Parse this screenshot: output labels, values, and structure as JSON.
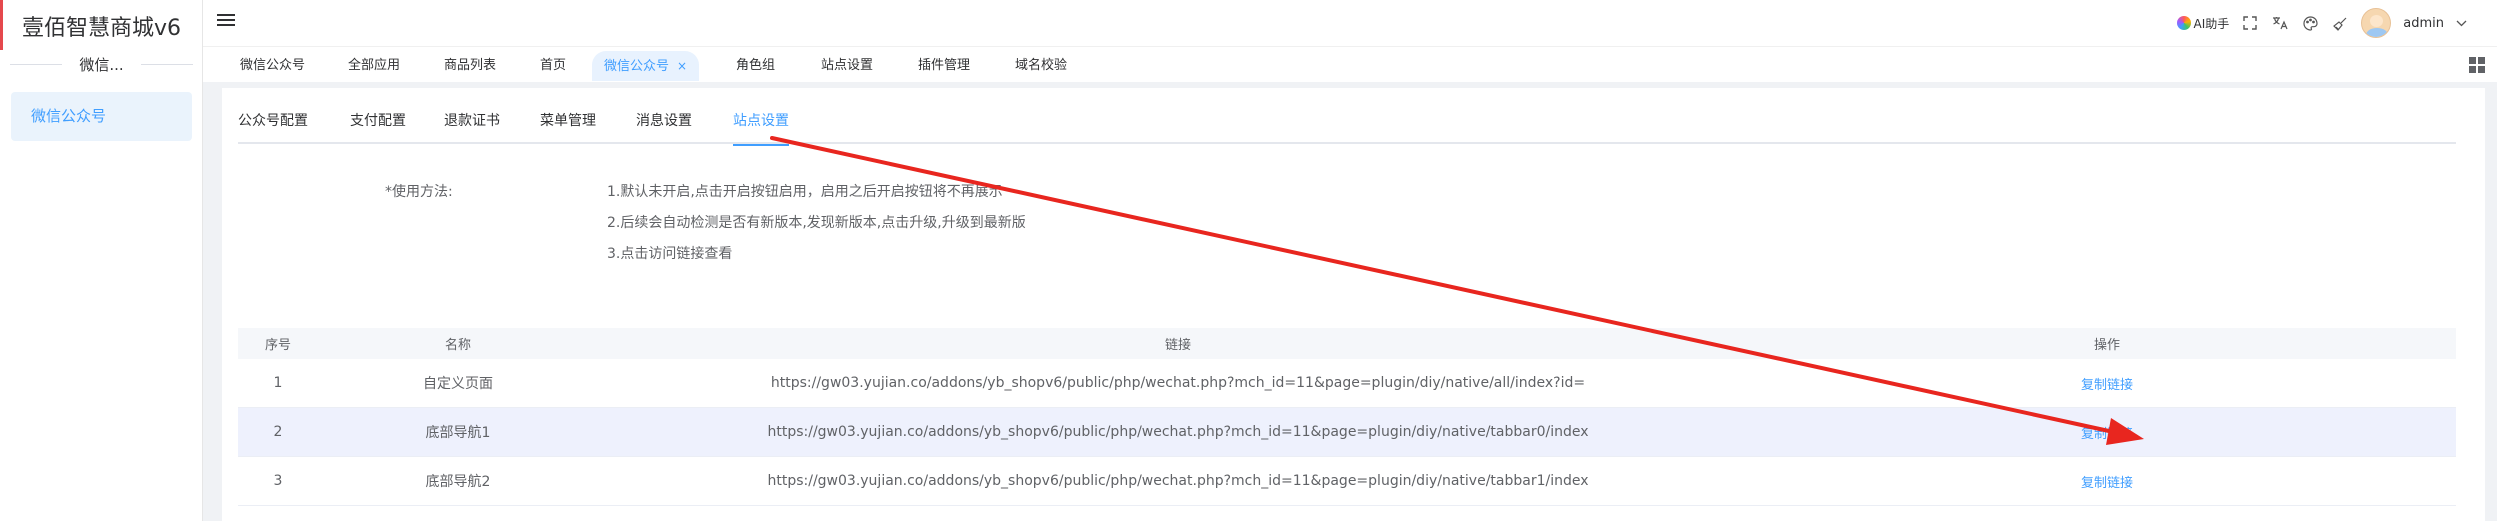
{
  "app": {
    "brand": "壹佰智慧商城v6"
  },
  "sidebar": {
    "group_label": "微信...",
    "items": [
      {
        "label": "微信公众号"
      }
    ]
  },
  "header": {
    "ai_label": "AI助手",
    "user_name": "admin"
  },
  "tags": [
    {
      "label": "微信公众号"
    },
    {
      "label": "全部应用"
    },
    {
      "label": "商品列表"
    },
    {
      "label": "首页"
    },
    {
      "label": "微信公众号",
      "close": "×"
    },
    {
      "label": "角色组"
    },
    {
      "label": "站点设置"
    },
    {
      "label": "插件管理"
    },
    {
      "label": "域名校验"
    }
  ],
  "subtabs": [
    {
      "label": "公众号配置"
    },
    {
      "label": "支付配置"
    },
    {
      "label": "退款证书"
    },
    {
      "label": "菜单管理"
    },
    {
      "label": "消息设置"
    },
    {
      "label": "站点设置"
    }
  ],
  "usage": {
    "label": "*使用方法:",
    "lines": [
      "1.默认未开启,点击开启按钮启用，启用之后开启按钮将不再展示",
      "2.后续会自动检测是否有新版本,发现新版本,点击升级,升级到最新版",
      "3.点击访问链接查看"
    ]
  },
  "table": {
    "headers": [
      "序号",
      "名称",
      "链接",
      "操作"
    ],
    "rows": [
      {
        "index": "1",
        "name": "自定义页面",
        "link": "https://gw03.yujian.co/addons/yb_shopv6/public/php/wechat.php?mch_id=11&page=plugin/diy/native/all/index?id=",
        "action": "复制链接"
      },
      {
        "index": "2",
        "name": "底部导航1",
        "link": "https://gw03.yujian.co/addons/yb_shopv6/public/php/wechat.php?mch_id=11&page=plugin/diy/native/tabbar0/index",
        "action": "复制链接"
      },
      {
        "index": "3",
        "name": "底部导航2",
        "link": "https://gw03.yujian.co/addons/yb_shopv6/public/php/wechat.php?mch_id=11&page=plugin/diy/native/tabbar1/index",
        "action": "复制链接"
      }
    ]
  },
  "colors": {
    "accent": "#409eff",
    "annotation_arrow": "#e8261f",
    "active_menu_bg": "#eaf3fc",
    "hover_row_bg": "#eef1fd"
  }
}
